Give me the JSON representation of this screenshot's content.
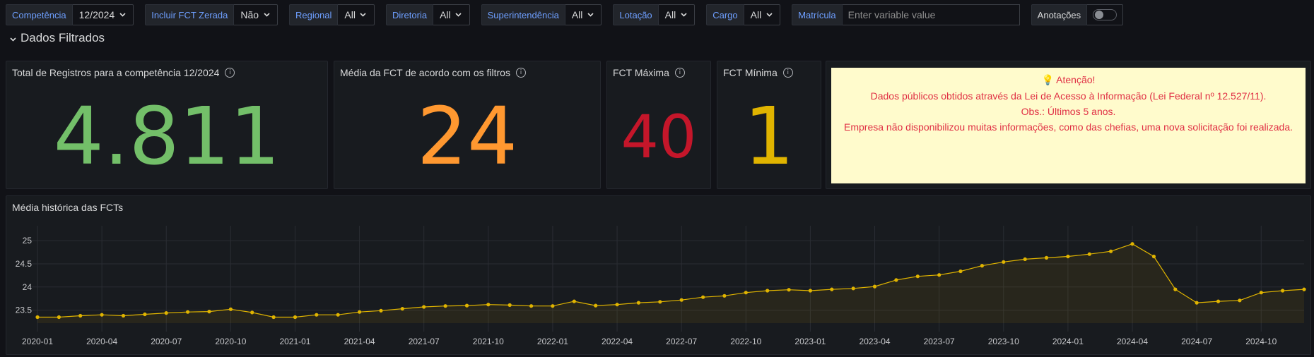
{
  "variables": {
    "competencia": {
      "label": "Competência",
      "value": "12/2024"
    },
    "incluir_fct": {
      "label": "Incluir FCT Zerada",
      "value": "Não"
    },
    "regional": {
      "label": "Regional",
      "value": "All"
    },
    "diretoria": {
      "label": "Diretoria",
      "value": "All"
    },
    "superintendencia": {
      "label": "Superintendência",
      "value": "All"
    },
    "lotacao": {
      "label": "Lotação",
      "value": "All"
    },
    "cargo": {
      "label": "Cargo",
      "value": "All"
    },
    "matricula": {
      "label": "Matrícula",
      "placeholder": "Enter variable value"
    },
    "anotacoes": {
      "label": "Anotações"
    }
  },
  "row": {
    "title": "Dados Filtrados"
  },
  "stats": {
    "total": {
      "title": "Total de Registros para a competência 12/2024",
      "value": "4.811",
      "color": "#73bf69"
    },
    "media": {
      "title": "Média da FCT de acordo com os filtros",
      "value": "24",
      "color": "#ff9830"
    },
    "maxima": {
      "title": "FCT Máxima",
      "value": "40",
      "color": "#c4162a"
    },
    "minima": {
      "title": "FCT Mínima",
      "value": "1",
      "color": "#e0b400"
    }
  },
  "notice": {
    "line1": "Atenção!",
    "line2": "Dados públicos obtidos através da Lei de Acesso à Informação (Lei Federal nº 12.527/11).",
    "line3": "Obs.: Últimos 5 anos.",
    "line4": "Empresa não disponibilizou muitas informações, como das chefias, uma nova solicitação foi realizada."
  },
  "chart_data": {
    "type": "line",
    "title": "Média histórica das FCTs",
    "ylim": [
      23.22,
      25.2
    ],
    "yticks": [
      23.5,
      24,
      24.5,
      25
    ],
    "xticks": [
      "2020-01",
      "2020-04",
      "2020-07",
      "2020-10",
      "2021-01",
      "2021-04",
      "2021-07",
      "2021-10",
      "2022-01",
      "2022-04",
      "2022-07",
      "2022-10",
      "2023-01",
      "2023-04",
      "2023-07",
      "2023-10",
      "2024-01",
      "2024-04",
      "2024-07",
      "2024-10"
    ],
    "x_start": "2020-01",
    "color": "#e0b400",
    "values": [
      23.35,
      23.35,
      23.38,
      23.4,
      23.38,
      23.41,
      23.44,
      23.46,
      23.47,
      23.52,
      23.45,
      23.35,
      23.35,
      23.4,
      23.4,
      23.46,
      23.49,
      23.53,
      23.57,
      23.59,
      23.6,
      23.62,
      23.61,
      23.59,
      23.59,
      23.69,
      23.6,
      23.62,
      23.66,
      23.68,
      23.72,
      23.78,
      23.81,
      23.88,
      23.92,
      23.94,
      23.92,
      23.95,
      23.97,
      24.01,
      24.15,
      24.23,
      24.26,
      24.34,
      24.46,
      24.54,
      24.6,
      24.63,
      24.66,
      24.71,
      24.77,
      24.93,
      24.66,
      23.95,
      23.66,
      23.69,
      23.71,
      23.88,
      23.92,
      23.95
    ]
  }
}
